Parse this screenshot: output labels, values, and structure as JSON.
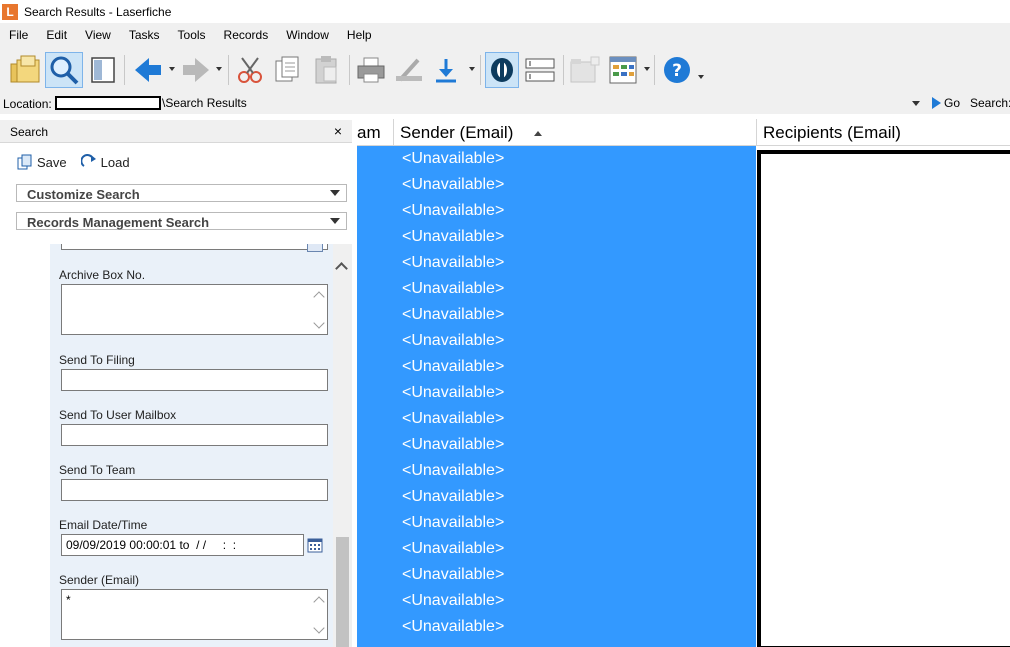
{
  "window": {
    "title": "Search Results - Laserfiche",
    "logo_letter": "L"
  },
  "menu": [
    "File",
    "Edit",
    "View",
    "Tasks",
    "Tools",
    "Records",
    "Window",
    "Help"
  ],
  "location": {
    "label": "Location:",
    "path": "\\Search Results",
    "go_label": "Go",
    "search_label": "Search:"
  },
  "search_pane": {
    "title": "Search",
    "close_glyph": "×",
    "save_label": "Save",
    "load_label": "Load",
    "sections": [
      "Customize Search",
      "Records Management Search"
    ],
    "fields": {
      "archive_box": {
        "label": "Archive Box No.",
        "value": ""
      },
      "send_to_filing": {
        "label": "Send To Filing",
        "value": ""
      },
      "send_to_user_mailbox": {
        "label": "Send To User Mailbox",
        "value": ""
      },
      "send_to_team": {
        "label": "Send To Team",
        "value": ""
      },
      "email_datetime": {
        "label": "Email Date/Time",
        "value": "09/09/2019 00:00:01 to  / /     :  :"
      },
      "sender_email": {
        "label": "Sender (Email)",
        "value": "*"
      }
    }
  },
  "results": {
    "columns": [
      "am",
      "Sender (Email)",
      "Recipients (Email)"
    ],
    "rows": [
      "<Unavailable>",
      "<Unavailable>",
      "<Unavailable>",
      "<Unavailable>",
      "<Unavailable>",
      "<Unavailable>",
      "<Unavailable>",
      "<Unavailable>",
      "<Unavailable>",
      "<Unavailable>",
      "<Unavailable>",
      "<Unavailable>",
      "<Unavailable>",
      "<Unavailable>",
      "<Unavailable>",
      "<Unavailable>",
      "<Unavailable>",
      "<Unavailable>",
      "<Unavailable>"
    ]
  },
  "colors": {
    "selection": "#3399ff",
    "form_bg": "#eaf1f9",
    "logo": "#e8762d",
    "accent_blue": "#1f7ad6"
  },
  "icons": [
    "open-folder-icon",
    "search-icon",
    "browser-pane-icon",
    "back-arrow-icon",
    "forward-arrow-icon",
    "cut-icon",
    "copy-icon",
    "paste-icon",
    "print-icon",
    "scan-icon",
    "download-icon",
    "ocr-icon",
    "template-fields-icon",
    "new-folder-icon",
    "columns-icon",
    "help-icon"
  ]
}
